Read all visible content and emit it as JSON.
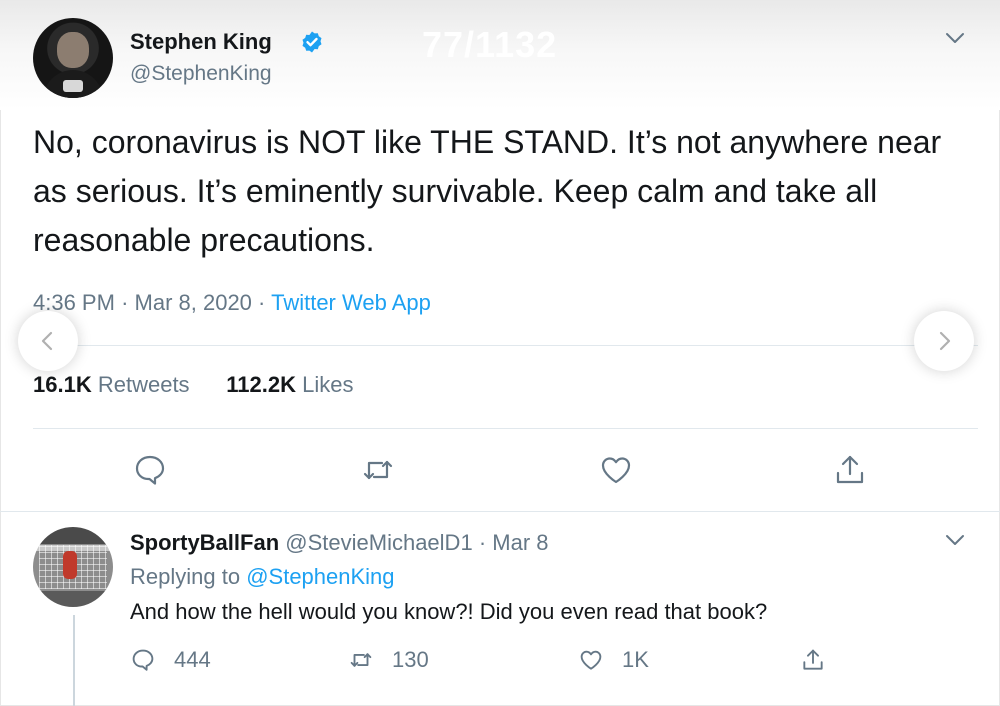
{
  "overlay": {
    "counter": "77/1132"
  },
  "tweet": {
    "author_name": "Stephen King",
    "handle": "@StephenKing",
    "text": "No, coronavirus is NOT like THE STAND. It’s not anywhere near as serious. It’s eminently survivable. Keep calm and take all reasonable precautions.",
    "time": "4:36 PM",
    "separator": "·",
    "date": "Mar 8, 2020",
    "source": "Twitter Web App",
    "retweets_count": "16.1K",
    "retweets_label": "Retweets",
    "likes_count": "112.2K",
    "likes_label": "Likes"
  },
  "reply": {
    "author_name": "SportyBallFan",
    "handle": "@StevieMichaelD1",
    "separator": "·",
    "date": "Mar 8",
    "replying_prefix": "Replying to",
    "replying_to": "@StephenKing",
    "text": "And how the hell would you know?! Did you even read that book?",
    "reply_count": "444",
    "retweet_count": "130",
    "like_count": "1K"
  },
  "icons": {
    "verified": "verified-badge-icon",
    "chevron": "chevron-down-icon",
    "reply": "comment-bubble-icon",
    "retweet": "retweet-arrows-icon",
    "like": "heart-icon",
    "share": "share-upload-icon",
    "prev": "chevron-left-icon",
    "next": "chevron-right-icon"
  },
  "colors": {
    "accent": "#1da1f2",
    "text": "#14171a",
    "muted": "#657786",
    "divider": "#e1e8ed"
  }
}
